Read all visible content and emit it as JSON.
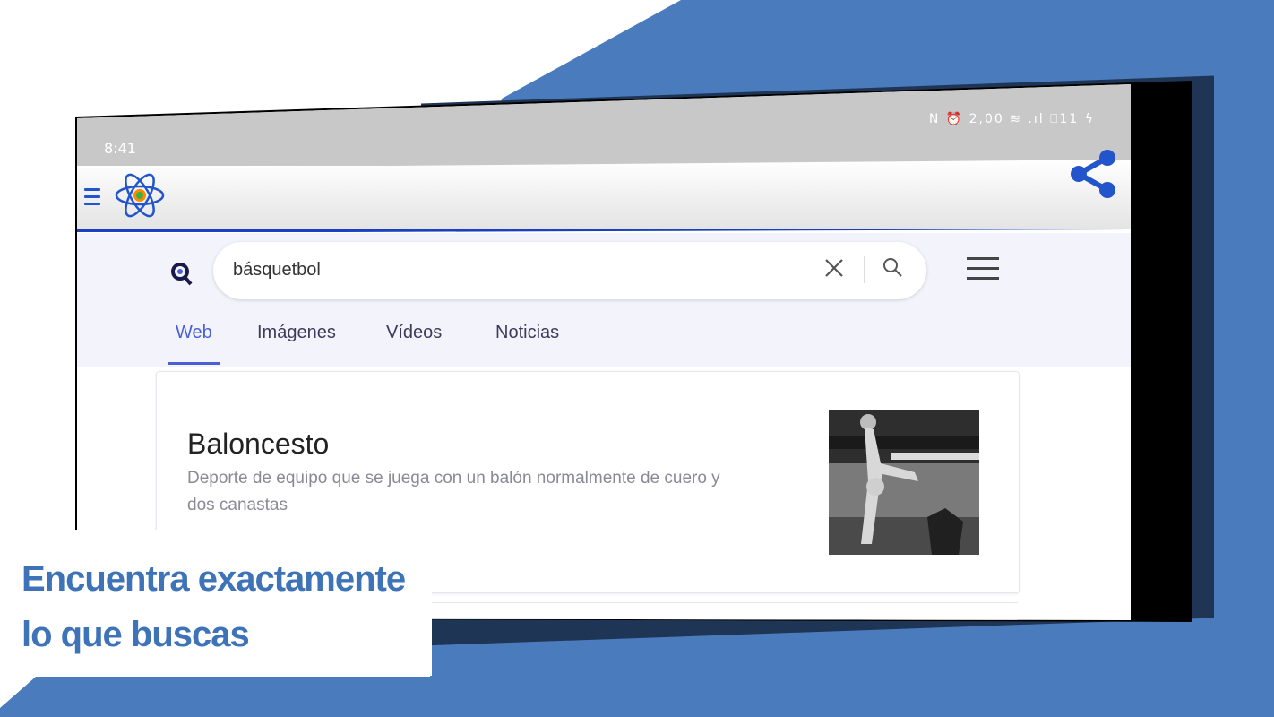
{
  "status": {
    "time": "8:41",
    "icons": "N ⏰ 2,00 ≋ .ıl ⎕11 ϟ"
  },
  "search": {
    "query": "básquetbol"
  },
  "tabs": [
    {
      "label": "Web",
      "active": true
    },
    {
      "label": "Imágenes",
      "active": false
    },
    {
      "label": "Vídeos",
      "active": false
    },
    {
      "label": "Noticias",
      "active": false
    }
  ],
  "result": {
    "title": "Baloncesto",
    "description": "Deporte de equipo que se juega con un balón normalmente de cuero y dos canastas"
  },
  "caption": {
    "line1": "Encuentra exactamente",
    "line2": "lo que buscas"
  },
  "colors": {
    "background_blue": "#4a7bbd",
    "caption_blue": "#3f73b8",
    "accent": "#4b5fd6",
    "appbar_line": "#1a3fbf"
  }
}
